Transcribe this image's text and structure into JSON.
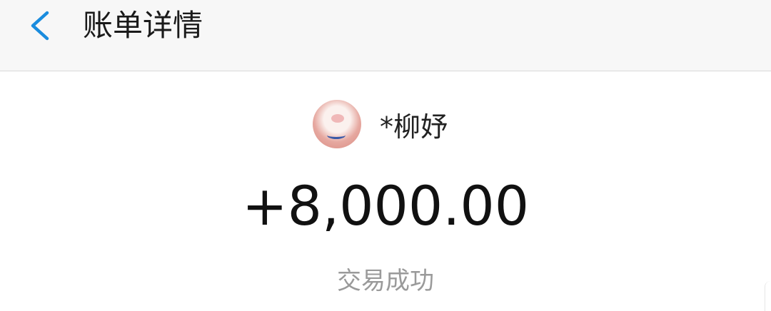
{
  "header": {
    "title": "账单详情",
    "back_icon": "chevron-left-icon"
  },
  "colors": {
    "accent": "#1a8cde",
    "amount": "#111111",
    "status": "#9a9a9a"
  },
  "payer": {
    "name": "*柳妤",
    "avatar_icon": "pig-avatar"
  },
  "transaction": {
    "amount": "+8,000.00",
    "status": "交易成功"
  }
}
